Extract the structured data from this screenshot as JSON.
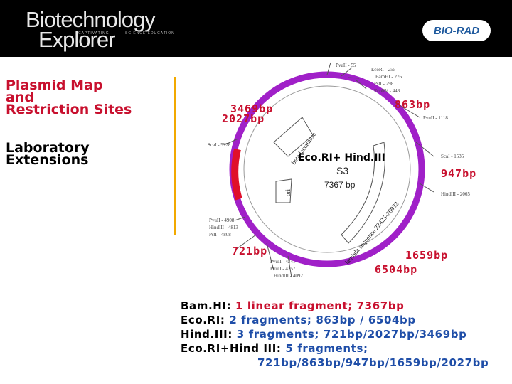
{
  "header": {
    "title_line1": "Biotechnology",
    "title_line2": "Explorer",
    "tag_left": "CAPTIVATING",
    "tag_right": "SCIENCE EDUCATION",
    "brand": "BIO-RAD"
  },
  "sidebar": {
    "heading": "Plasmid Map and Restriction Sites",
    "heading_lines": [
      "Plasmid Map",
      "and",
      "Restriction Sites"
    ],
    "subheading_lines": [
      "Laboratory",
      "Extensions"
    ]
  },
  "plasmid": {
    "name": "S3",
    "size": "7367 bp",
    "enzymes_label": "Eco.RI+ Hind.III",
    "gene_labels": [
      "beta lactamase",
      "lambda sequence 22425-26932",
      "ori"
    ],
    "sites": [
      "PvuII - 55",
      "EcoRI - 255",
      "BamHI - 276",
      "PstI - 298",
      "EcoRV - 443",
      "PvuII - 1118",
      "ScaI - 1535",
      "HindIII - 2065",
      "ScaI - 5978",
      "PvuII - 4908",
      "HindIII - 4813",
      "PstI - 4808",
      "PvuII - 4241",
      "PvuII - 4257",
      "HindIII - 4092"
    ]
  },
  "fragments": {
    "f1": "3469bp",
    "f2": "2027bp",
    "f3": "863bp",
    "f4": "947bp",
    "f5": "721bp",
    "f6": "1659bp",
    "f7": "6504bp"
  },
  "summary": {
    "bam_label": "Bam.HI:",
    "bam_value": "1 linear fragment; 7367bp",
    "eco_label": "Eco.RI:",
    "eco_value": "2 fragments; 863bp / 6504bp",
    "hind_label": "Hind.III:",
    "hind_value": "3 fragments; 721bp/2027bp/3469bp",
    "combo_label": "Eco.RI+Hind III:",
    "combo_value": "5 fragments;",
    "combo_list": "721bp/863bp/947bp/1659bp/2027bp"
  },
  "colors": {
    "accent_red": "#c8102e",
    "accent_blue": "#1f4ea8",
    "plasmid_purple": "#a020c8",
    "divider_gold": "#f2a900"
  }
}
